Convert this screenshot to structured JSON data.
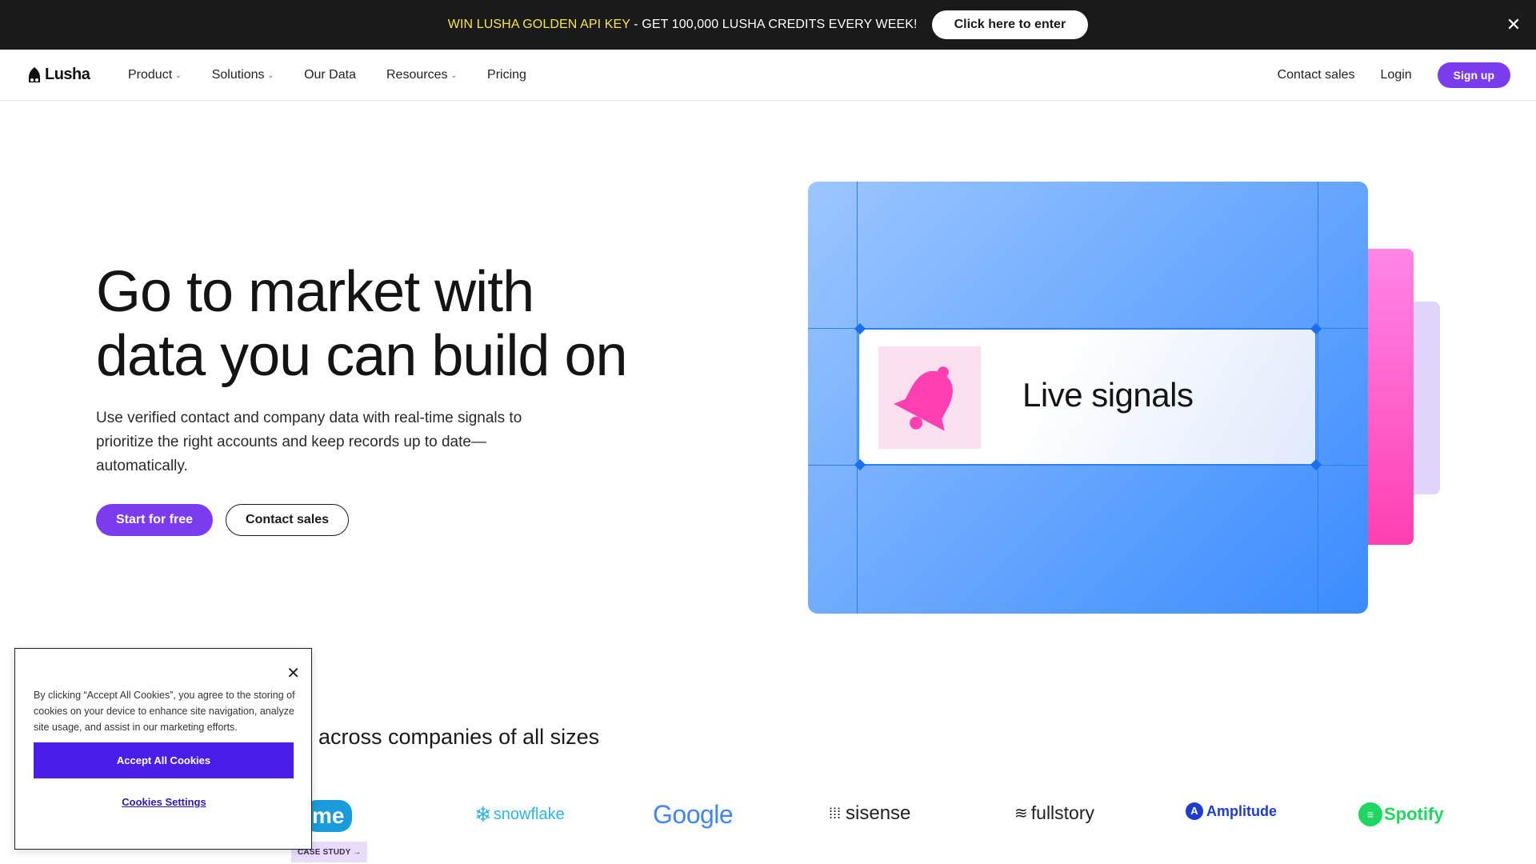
{
  "promo": {
    "highlight": "WIN LUSHA GOLDEN API KEY",
    "text": " - GET 100,000 LUSHA CREDITS EVERY WEEK!",
    "button": "Click here to enter",
    "close_icon": "close-icon"
  },
  "nav": {
    "logo": "Lusha",
    "items": [
      {
        "label": "Product",
        "dropdown": true
      },
      {
        "label": "Solutions",
        "dropdown": true
      },
      {
        "label": "Our Data",
        "dropdown": false
      },
      {
        "label": "Resources",
        "dropdown": true
      },
      {
        "label": "Pricing",
        "dropdown": false
      }
    ],
    "contact_sales": "Contact sales",
    "login": "Login",
    "signup": "Sign up"
  },
  "hero": {
    "title_line1": "Go to market with",
    "title_line2": "data you can build on",
    "subtitle": "Use verified contact and company data with real-time signals to prioritize the right accounts and keep records up to date—automatically.",
    "cta_primary": "Start for free",
    "cta_secondary": "Contact sales"
  },
  "illustration": {
    "label": "Live signals",
    "icon": "bell-icon",
    "colors": {
      "accent_blue": "#3b8cff",
      "accent_pink": "#ff3fb2",
      "accent_lilac": "#e0d4fb"
    }
  },
  "logos": {
    "heading": "across companies of all sizes",
    "items": [
      "me",
      "snowflake",
      "Google",
      "sisense",
      "fullstory",
      "Amplitude",
      "Spotify"
    ],
    "case_study": "CASE STUDY →"
  },
  "cookie": {
    "text": "By clicking “Accept All Cookies”, you agree to the storing of cookies on your device to enhance site navigation, analyze site usage, and assist in our marketing efforts.",
    "accept": "Accept All Cookies",
    "settings": "Cookies Settings"
  },
  "colors": {
    "brand": "#7b3cf0",
    "promo_bg": "#1a1a1a",
    "promo_highlight": "#f5e74b",
    "cookie_accept": "#4a1ee8"
  }
}
